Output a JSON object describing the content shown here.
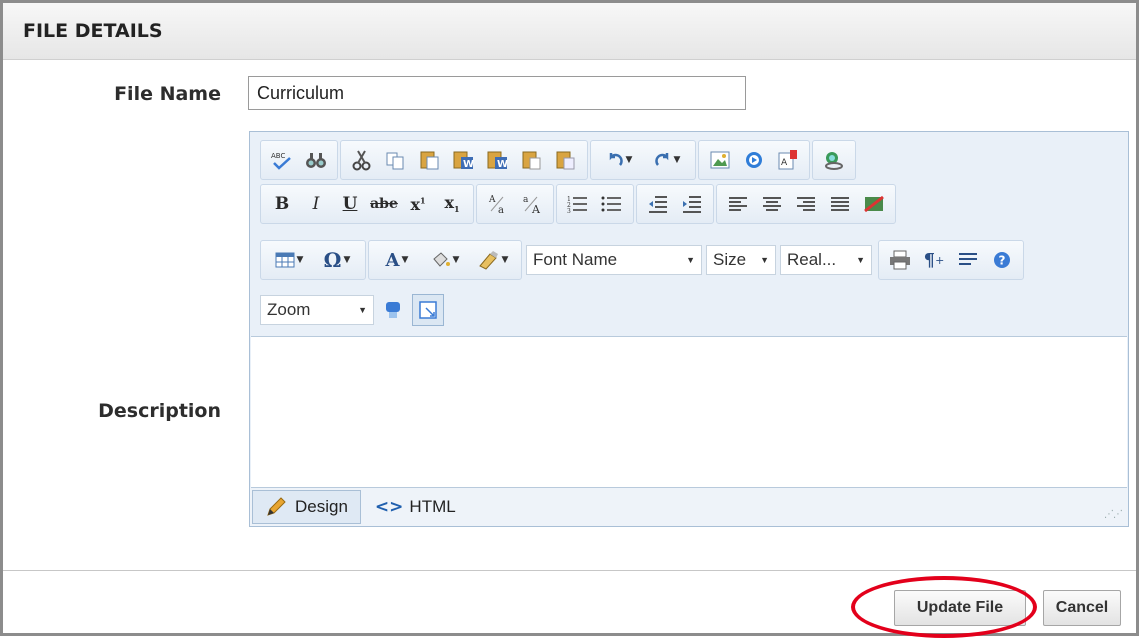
{
  "panel": {
    "title": "FILE DETAILS"
  },
  "form": {
    "file_name_label": "File Name",
    "file_name_value": "Curriculum",
    "description_label": "Description"
  },
  "editor": {
    "font_name_placeholder": "Font Name",
    "size_placeholder": "Size",
    "paragraph_style_placeholder": "Real...",
    "zoom_label": "Zoom",
    "design_tab": "Design",
    "html_tab": "HTML",
    "design_tab_icon": "pencil-icon",
    "html_tab_icon": "code-brackets-icon",
    "toolbar_row1": [
      "spellcheck-icon",
      "find-icon",
      "cut-icon",
      "copy-icon",
      "paste-icon",
      "paste-from-word-icon",
      "paste-plain-text-icon",
      "paste-html-icon",
      "paste-as-html-icon",
      "undo-icon",
      "redo-icon",
      "image-manager-icon",
      "media-manager-icon",
      "flash-manager-icon",
      "hyperlink-icon"
    ],
    "toolbar_row2": [
      "bold-icon",
      "italic-icon",
      "underline-icon",
      "strikethrough-icon",
      "superscript-icon",
      "subscript-icon",
      "convert-lower-icon",
      "convert-upper-icon",
      "ordered-list-icon",
      "unordered-list-icon",
      "outdent-icon",
      "indent-icon",
      "align-left-icon",
      "align-center-icon",
      "align-right-icon",
      "justify-icon",
      "clear-formatting-icon"
    ],
    "toolbar_row3": [
      "insert-table-icon",
      "insert-symbol-icon",
      "font-color-icon",
      "background-color-icon",
      "format-stripper-icon",
      "print-icon",
      "paragraph-icon",
      "format-block-icon",
      "help-icon"
    ],
    "toolbar_row4": [
      "module-manager-icon",
      "toggle-screen-icon"
    ]
  },
  "buttons": {
    "update": "Update File",
    "cancel": "Cancel"
  },
  "colors": {
    "highlight": "#e3001b",
    "editor_border": "#a9bfd6",
    "toolbar_bg": "#e9f0f8"
  }
}
